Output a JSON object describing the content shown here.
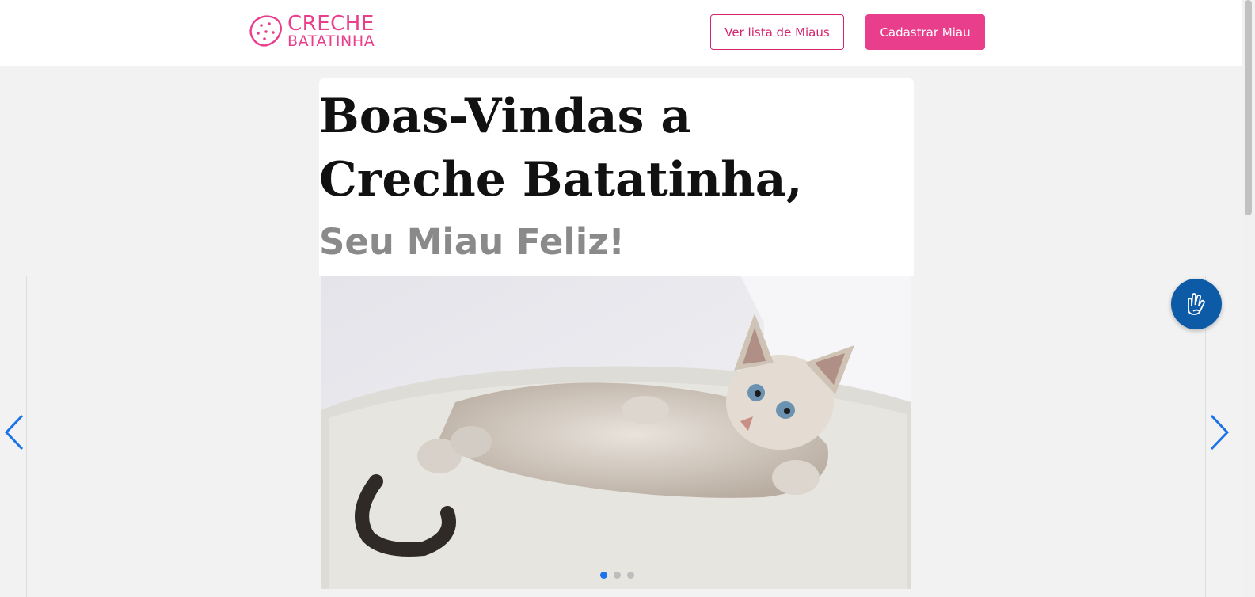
{
  "header": {
    "logo_line1": "CRECHE",
    "logo_line2": "BATATINHA",
    "list_button": "Ver lista de Miaus",
    "register_button": "Cadastrar Miau"
  },
  "hero": {
    "title": "Boas-Vindas a Creche Batatinha,",
    "subtitle": "Seu Miau Feliz!"
  },
  "carousel": {
    "slide_count": 3,
    "active_index": 0
  },
  "colors": {
    "brand_pink": "#e83e8c",
    "arrow_blue": "#1a73e8",
    "vlibras_blue": "#0d5aa7"
  },
  "icons": {
    "logo": "potato-icon",
    "prev": "chevron-left-icon",
    "next": "chevron-right-icon",
    "accessibility": "sign-language-hands-icon"
  }
}
